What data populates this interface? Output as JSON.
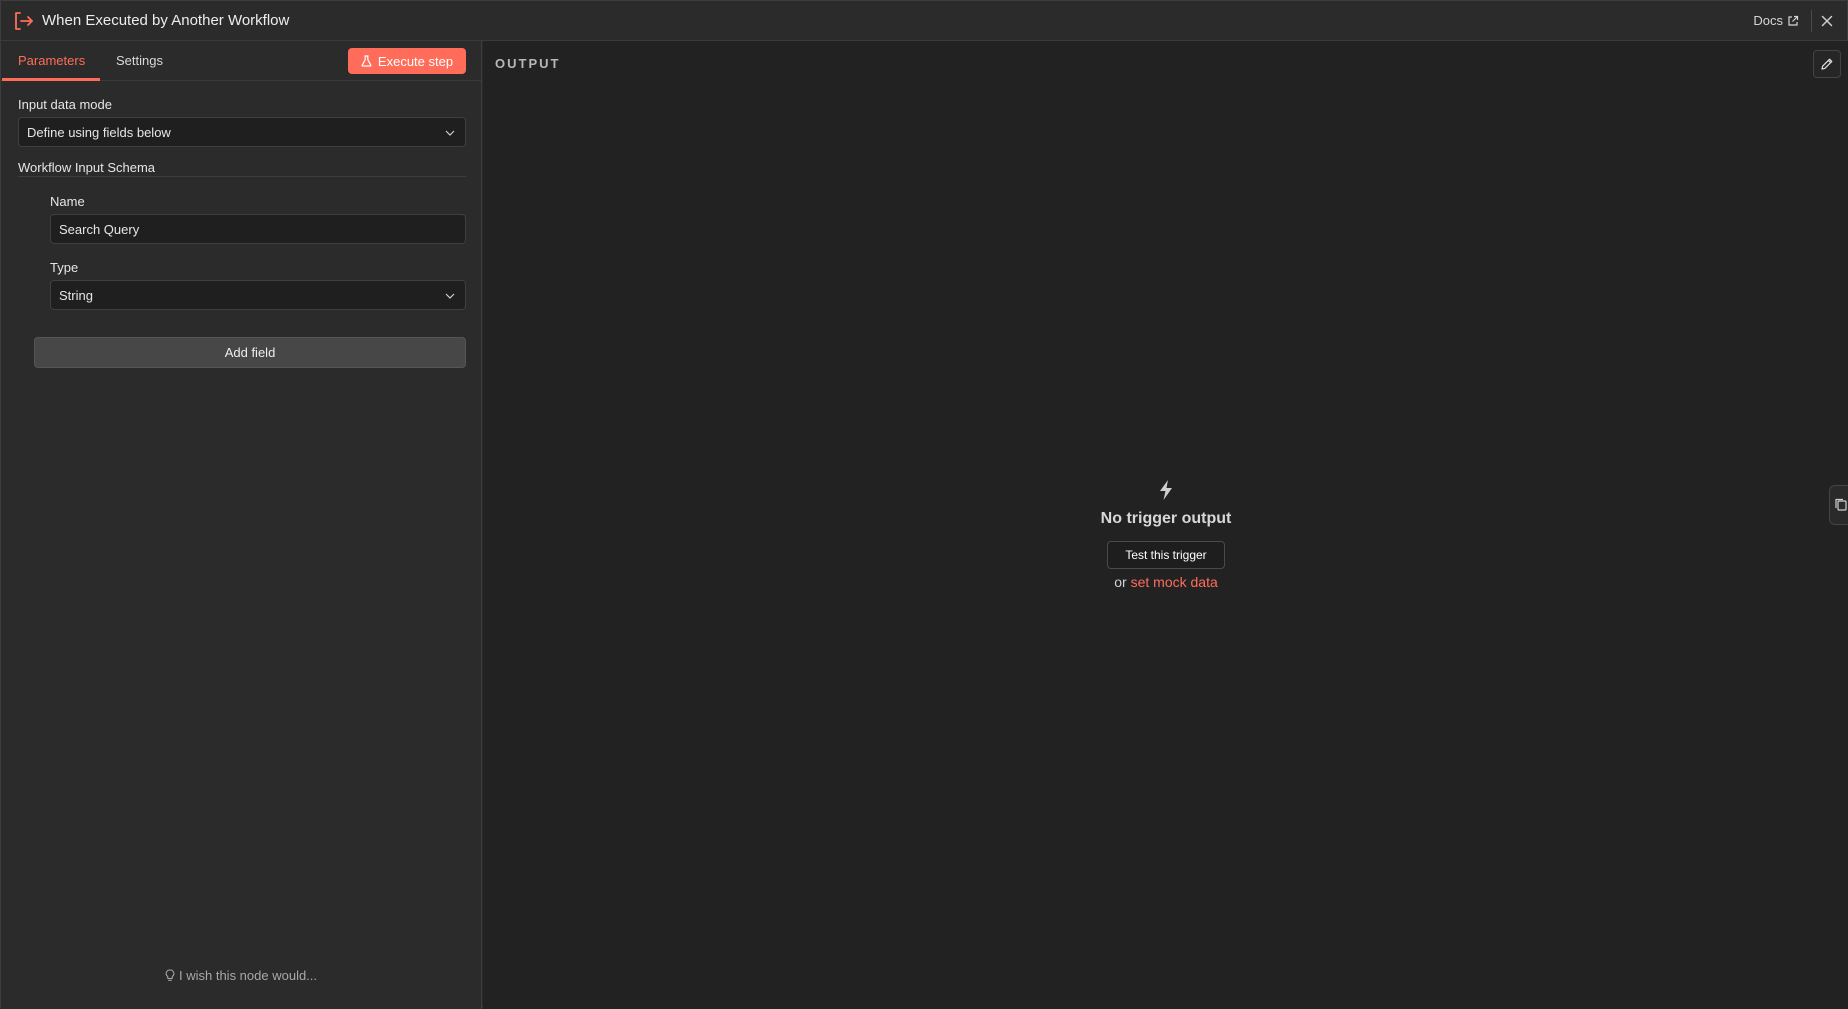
{
  "header": {
    "title": "When Executed by Another Workflow",
    "docs_label": "Docs",
    "node_icon": "sign-in-icon",
    "close_icon": "close-icon"
  },
  "tabs": [
    {
      "label": "Parameters",
      "active": true
    },
    {
      "label": "Settings",
      "active": false
    }
  ],
  "execute_step": {
    "label": "Execute step",
    "icon": "flask-icon"
  },
  "parameters": {
    "input_data_mode": {
      "label": "Input data mode",
      "value": "Define using fields below"
    },
    "schema": {
      "title": "Workflow Input Schema",
      "fields": [
        {
          "name_label": "Name",
          "name_value": "Search Query",
          "type_label": "Type",
          "type_value": "String"
        }
      ]
    },
    "add_field_label": "Add field"
  },
  "feedback": {
    "label": "I wish this node would...",
    "icon": "lightbulb-icon"
  },
  "output": {
    "label": "OUTPUT",
    "empty_title": "No trigger output",
    "test_button_label": "Test this trigger",
    "or_text": "or",
    "mock_link_label": "set mock data",
    "empty_icon": "bolt-icon",
    "edit_icon": "pencil-icon"
  },
  "colors": {
    "accent": "#ff6d5a",
    "background": "#2b2b2b",
    "output_background": "#222222"
  }
}
